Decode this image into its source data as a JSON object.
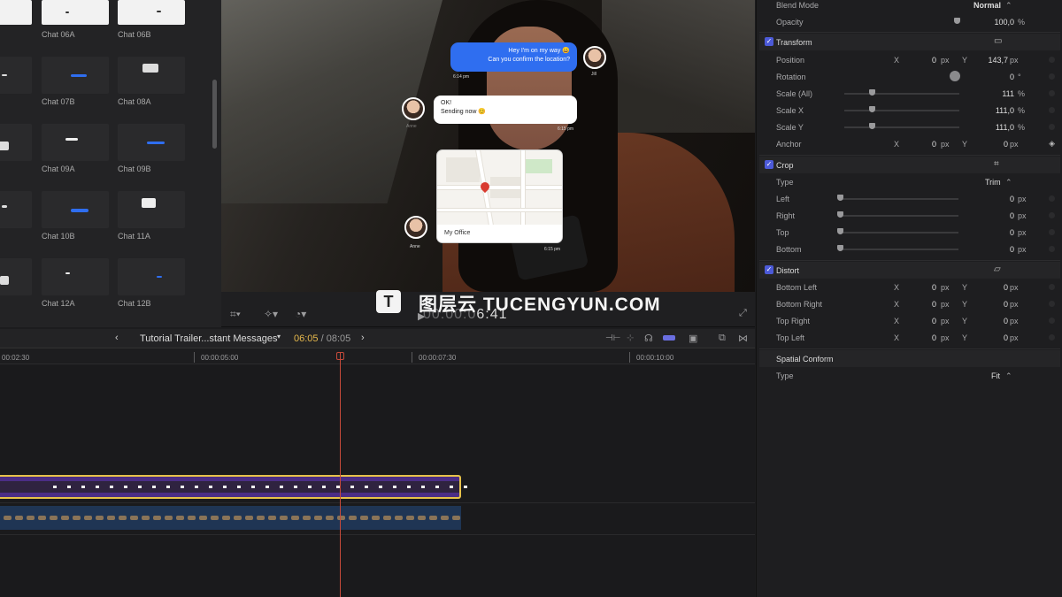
{
  "browser": {
    "items": [
      {
        "label": "Chat 06A"
      },
      {
        "label": "Chat 06B"
      },
      {
        "label": "Chat 07B"
      },
      {
        "label": "Chat 08A"
      },
      {
        "label": "Chat 09A"
      },
      {
        "label": "Chat 09B"
      },
      {
        "label": "Chat 10B"
      },
      {
        "label": "Chat 11A"
      },
      {
        "label": "Chat 12A"
      },
      {
        "label": "Chat 12B"
      }
    ]
  },
  "viewer": {
    "msg_blue_line1": "Hey I'm on my way 😀",
    "msg_blue_line2": "Can you confirm the location?",
    "time1": "6:14 pm",
    "name_jill": "Jill",
    "msg_white_line1": "OK!",
    "msg_white_line2": "Sending now 😊",
    "time2": "6:15 pm",
    "name_anne_faded": "Anne",
    "map_caption": "My Office",
    "time3": "6:15 pm",
    "name_anne": "Anne",
    "timecode_dim": "00:00:0",
    "timecode": "6:41"
  },
  "watermark": {
    "logo": "T",
    "text": "图层云  TUCENGYUN.COM"
  },
  "timeline": {
    "project": "Tutorial Trailer...stant Messages",
    "current": "06:05",
    "separator": " / ",
    "duration": "08:05",
    "ruler": [
      "00:02:30",
      "00:00:05:00",
      "00:00:07:30",
      "00:00:10:00"
    ]
  },
  "inspector": {
    "blend_mode": {
      "label": "Blend Mode",
      "value": "Normal"
    },
    "opacity": {
      "label": "Opacity",
      "value": "100,0",
      "unit": "%"
    },
    "transform": {
      "label": "Transform",
      "position": {
        "label": "Position",
        "x_label": "X",
        "x": "0",
        "x_unit": "px",
        "y_label": "Y",
        "y": "143,7",
        "y_unit": "px"
      },
      "rotation": {
        "label": "Rotation",
        "value": "0",
        "unit": "°"
      },
      "scale_all": {
        "label": "Scale (All)",
        "value": "111",
        "unit": "%"
      },
      "scale_x": {
        "label": "Scale X",
        "value": "111,0",
        "unit": "%"
      },
      "scale_y": {
        "label": "Scale Y",
        "value": "111,0",
        "unit": "%"
      },
      "anchor": {
        "label": "Anchor",
        "x_label": "X",
        "x": "0",
        "x_unit": "px",
        "y_label": "Y",
        "y": "0",
        "y_unit": "px"
      }
    },
    "crop": {
      "label": "Crop",
      "type": {
        "label": "Type",
        "value": "Trim"
      },
      "left": {
        "label": "Left",
        "value": "0",
        "unit": "px"
      },
      "right": {
        "label": "Right",
        "value": "0",
        "unit": "px"
      },
      "top": {
        "label": "Top",
        "value": "0",
        "unit": "px"
      },
      "bottom": {
        "label": "Bottom",
        "value": "0",
        "unit": "px"
      }
    },
    "distort": {
      "label": "Distort",
      "bottom_left": {
        "label": "Bottom Left",
        "x_label": "X",
        "x": "0",
        "x_unit": "px",
        "y_label": "Y",
        "y": "0",
        "y_unit": "px"
      },
      "bottom_right": {
        "label": "Bottom Right",
        "x_label": "X",
        "x": "0",
        "x_unit": "px",
        "y_label": "Y",
        "y": "0",
        "y_unit": "px"
      },
      "top_right": {
        "label": "Top Right",
        "x_label": "X",
        "x": "0",
        "x_unit": "px",
        "y_label": "Y",
        "y": "0",
        "y_unit": "px"
      },
      "top_left": {
        "label": "Top Left",
        "x_label": "X",
        "x": "0",
        "x_unit": "px",
        "y_label": "Y",
        "y": "0",
        "y_unit": "px"
      }
    },
    "spatial_conform": {
      "label": "Spatial Conform",
      "type_label": "Type",
      "type_value": "Fit"
    }
  },
  "colors": {
    "accent": "#4c5ad8",
    "playhead": "#c64a3a",
    "clip_border": "#e7c24a",
    "current_time": "#e6b84c"
  }
}
